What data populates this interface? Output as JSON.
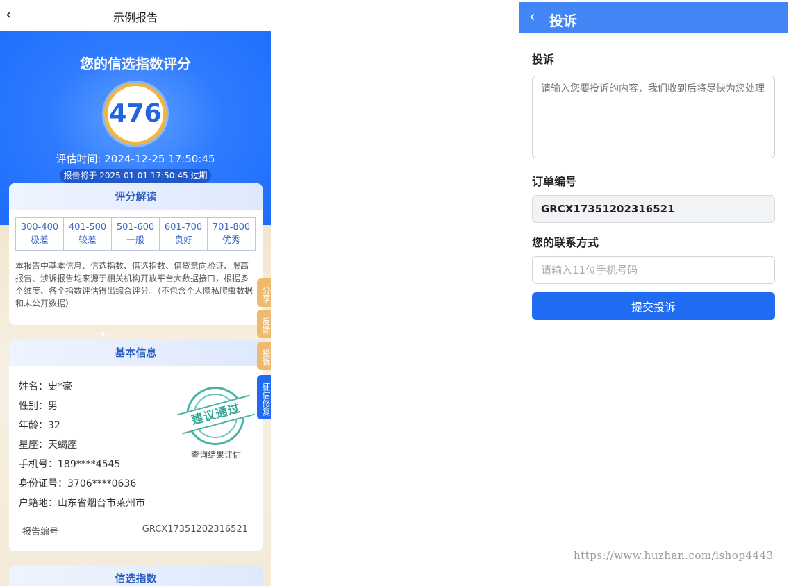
{
  "left": {
    "back_icon": "chevron-left-icon",
    "title": "示例报告",
    "hero": {
      "heading": "您的信选指数评分",
      "score": "476",
      "eval_time": "评估时间: 2024-12-25 17:50:45",
      "expire_notice": "报告将于 2025-01-01 17:50:45 过期"
    },
    "score_card": {
      "title": "评分解读",
      "ranges": [
        {
          "range": "300-400",
          "label": "极差"
        },
        {
          "range": "401-500",
          "label": "较差"
        },
        {
          "range": "501-600",
          "label": "一般"
        },
        {
          "range": "601-700",
          "label": "良好"
        },
        {
          "range": "701-800",
          "label": "优秀"
        }
      ],
      "description": "本报告中基本信息、信选指数、借选指数、借贷意向验证、限高报告、涉诉报告均来源于相关机构开放平台大数据接口，根据多个维度、各个指数评估得出综合评分。（不包含个人隐私爬虫数据和未公开数据）"
    },
    "basic_card": {
      "title": "基本信息",
      "rows": [
        "姓名：史*豪",
        "性别：男",
        "年龄：32",
        "星座：天蝎座",
        "手机号：189****4545",
        "身份证号：3706****0636",
        "户籍地：山东省烟台市莱州市"
      ],
      "stamp_text": "建议通过",
      "stamp_caption": "查询结果评估",
      "report_no_label": "报告编号",
      "report_no_value": "GRCX17351202316521"
    },
    "next_card": {
      "title": "信选指数"
    },
    "side_tabs": {
      "share": "分享",
      "feedback": "反馈",
      "complain": "投诉",
      "repair": "征信修复"
    }
  },
  "right": {
    "back_icon": "chevron-left-icon",
    "title": "投诉",
    "complaint_label": "投诉",
    "complaint_placeholder": "请输入您要投诉的内容，我们收到后将尽快为您处理",
    "order_label": "订单编号",
    "order_value": "GRCX17351202316521",
    "contact_label": "您的联系方式",
    "contact_placeholder": "请输入11位手机号码",
    "submit_label": "提交投诉"
  },
  "watermark": "https://www.huzhan.com/ishop4443",
  "colors": {
    "primary_blue": "#1f6cf3",
    "header_blue": "#4286f5",
    "score_ring": "#f2b63c",
    "side_tab_orange": "#eeba6d",
    "stamp_green": "#4ab3a8"
  }
}
